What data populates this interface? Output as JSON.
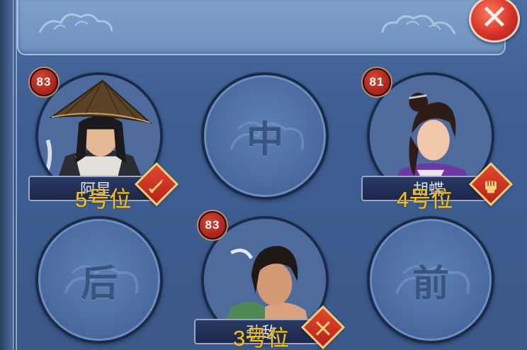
{
  "slots": [
    {
      "id": "slot-top-left",
      "level": "83",
      "name": "阿星",
      "position_label": "5号位",
      "role": "sword"
    },
    {
      "id": "slot-top-center",
      "empty_label": "中"
    },
    {
      "id": "slot-top-right",
      "level": "81",
      "name": "胡蝶",
      "position_label": "4号位",
      "role": "fist"
    },
    {
      "id": "slot-bottom-left",
      "empty_label": "后"
    },
    {
      "id": "slot-bottom-center",
      "level": "83",
      "name": "劲敌",
      "position_label": "3号位",
      "role": "twin-swords"
    },
    {
      "id": "slot-bottom-right",
      "empty_label": "前"
    }
  ],
  "close_button": {
    "icon": "close-icon",
    "symbol": "✕"
  },
  "colors": {
    "panel": "#3f5f93",
    "close_button": "#d6332a",
    "level_badge": "#a9211b",
    "position_text": "#f2c21a",
    "role_icon": "#e34830"
  }
}
